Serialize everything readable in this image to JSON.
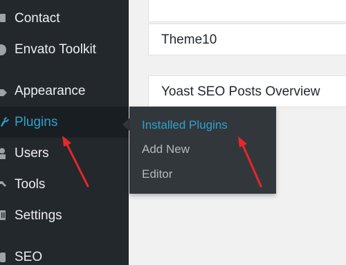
{
  "sidebar": {
    "items": [
      {
        "label": "Contact",
        "icon": "envelope-icon"
      },
      {
        "label": "Envato Toolkit",
        "icon": "leaf-icon"
      },
      {
        "label": "Appearance",
        "icon": "paintbrush-icon"
      },
      {
        "label": "Plugins",
        "icon": "plug-icon",
        "active": true
      },
      {
        "label": "Users",
        "icon": "user-icon"
      },
      {
        "label": "Tools",
        "icon": "wrench-icon"
      },
      {
        "label": "Settings",
        "icon": "sliders-icon"
      },
      {
        "label": "SEO",
        "icon": "seo-icon"
      }
    ]
  },
  "submenu": {
    "items": [
      {
        "label": "Installed Plugins",
        "current": true
      },
      {
        "label": "Add New"
      },
      {
        "label": "Editor"
      }
    ]
  },
  "content": {
    "cards": [
      {
        "title": ""
      },
      {
        "title": "Theme10"
      },
      {
        "title": "Yoast SEO Posts Overview"
      }
    ]
  },
  "annotations": {
    "arrow_color": "#e8262b"
  },
  "colors": {
    "sidebar_bg": "#23282d",
    "submenu_bg": "#32373c",
    "accent": "#2ea2cc",
    "content_bg": "#f1f1f1"
  }
}
